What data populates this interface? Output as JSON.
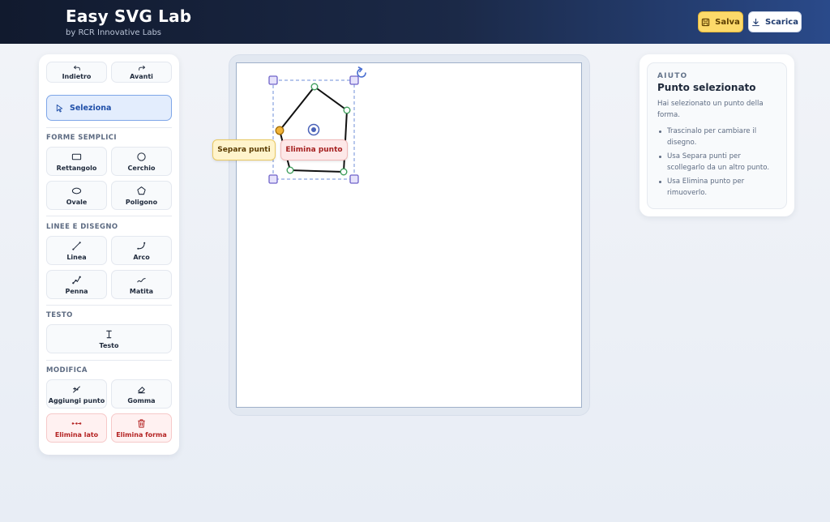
{
  "header": {
    "title": "Easy SVG Lab",
    "subtitle": "by RCR Innovative Labs",
    "save_label": "Salva",
    "download_label": "Scarica"
  },
  "history": {
    "undo_label": "Indietro",
    "redo_label": "Avanti"
  },
  "select_label": "Seleziona",
  "sections": {
    "simple_shapes": "FORME SEMPLICI",
    "lines_drawing": "LINEE E DISEGNO",
    "text": "TESTO",
    "modify": "MODIFICA"
  },
  "tools": {
    "rectangle": "Rettangolo",
    "circle": "Cerchio",
    "oval": "Ovale",
    "polygon": "Poligono",
    "line": "Linea",
    "arc": "Arco",
    "pen": "Penna",
    "pencil": "Matita",
    "text": "Testo",
    "add_point": "Aggiungi punto",
    "eraser": "Gomma",
    "delete_side": "Elimina lato",
    "delete_shape": "Elimina forma"
  },
  "canvas": {
    "split_points_label": "Separa punti",
    "delete_point_label": "Elimina punto"
  },
  "help": {
    "kicker": "AIUTO",
    "title": "Punto selezionato",
    "description": "Hai selezionato un punto della forma.",
    "tips": [
      "Trascinalo per cambiare il disegno.",
      "Usa Separa punti per scollegarlo da un altro punto.",
      "Usa Elimina punto per rimuoverlo."
    ]
  },
  "colors": {
    "header_start": "#111a2e",
    "header_end": "#2a4a8a",
    "save_button": "#fcd96a",
    "selection_accent": "#6f63c9",
    "vertex_green": "#3f9e5c",
    "selected_point": "#f1b43a",
    "danger": "#b42323"
  },
  "icons": {
    "save": "floppy-disk-icon",
    "download": "download-icon",
    "undo": "undo-arrow-icon",
    "redo": "redo-arrow-icon",
    "select": "cursor-arrow-icon",
    "rotate": "rotate-icon"
  }
}
